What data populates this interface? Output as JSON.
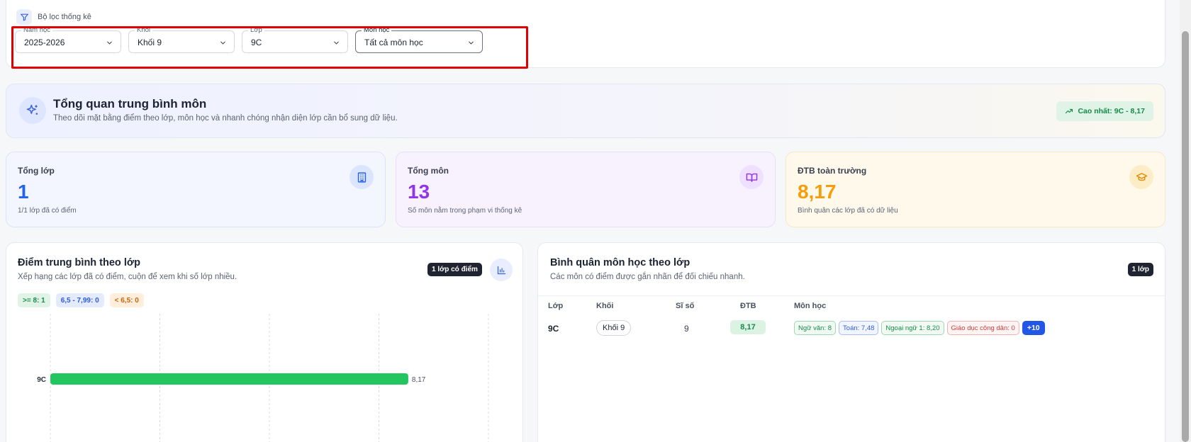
{
  "filter": {
    "title": "Bộ lọc thống kê",
    "selects": [
      {
        "label": "Năm học",
        "value": "2025-2026"
      },
      {
        "label": "Khối",
        "value": "Khối 9"
      },
      {
        "label": "Lớp",
        "value": "9C"
      },
      {
        "label": "Môn học",
        "value": "Tất cả môn học"
      }
    ]
  },
  "overview": {
    "title": "Tổng quan trung bình môn",
    "subtitle": "Theo dõi mặt bằng điểm theo lớp, môn học và nhanh chóng nhận diện lớp cần bổ sung dữ liệu.",
    "highlight": "Cao nhất: 9C - 8,17"
  },
  "stats": [
    {
      "label": "Tổng lớp",
      "value": "1",
      "note": "1/1 lớp đã có điểm",
      "color": "#2563eb",
      "icon": "building-icon"
    },
    {
      "label": "Tổng môn",
      "value": "13",
      "note": "Số môn nằm trong phạm vi thống kê",
      "color": "#9333ea",
      "icon": "book-icon"
    },
    {
      "label": "ĐTB toàn trường",
      "value": "8,17",
      "note": "Bình quân các lớp đã có dữ liệu",
      "color": "#f59e0b",
      "icon": "graduation-cap-icon"
    }
  ],
  "class_chart": {
    "title": "Điểm trung bình theo lớp",
    "subtitle": "Xếp hạng các lớp đã có điểm, cuộn để xem khi số lớp nhiều.",
    "badge": "1 lớp có điểm",
    "legend": [
      {
        "text": ">= 8: 1",
        "color": "#22c55e"
      },
      {
        "text": "6,5 - 7,99: 0",
        "color": "#3b82f6"
      },
      {
        "text": "< 6,5: 0",
        "color": "#f97316"
      }
    ]
  },
  "chart_data": {
    "type": "bar",
    "orientation": "horizontal",
    "categories": [
      "9C"
    ],
    "values": [
      8.17
    ],
    "value_labels": [
      "8,17"
    ],
    "bar_color": "#22c55e",
    "xlim": [
      0,
      10
    ],
    "grid": true
  },
  "subject_table": {
    "title": "Bình quân môn học theo lớp",
    "subtitle": "Các môn có điểm được gắn nhãn để đối chiếu nhanh.",
    "badge": "1 lớp",
    "columns": [
      "Lớp",
      "Khối",
      "Sĩ số",
      "ĐTB",
      "Môn học"
    ],
    "rows": [
      {
        "class": "9C",
        "grade": "Khối 9",
        "size": "9",
        "avg": "8,17",
        "subjects": [
          {
            "text": "Ngữ văn: 8",
            "tone": "green"
          },
          {
            "text": "Toán: 7,48",
            "tone": "blue"
          },
          {
            "text": "Ngoại ngữ 1: 8,20",
            "tone": "green"
          },
          {
            "text": "Giáo dục công dân: 0",
            "tone": "red"
          }
        ],
        "more": "+10"
      }
    ]
  }
}
